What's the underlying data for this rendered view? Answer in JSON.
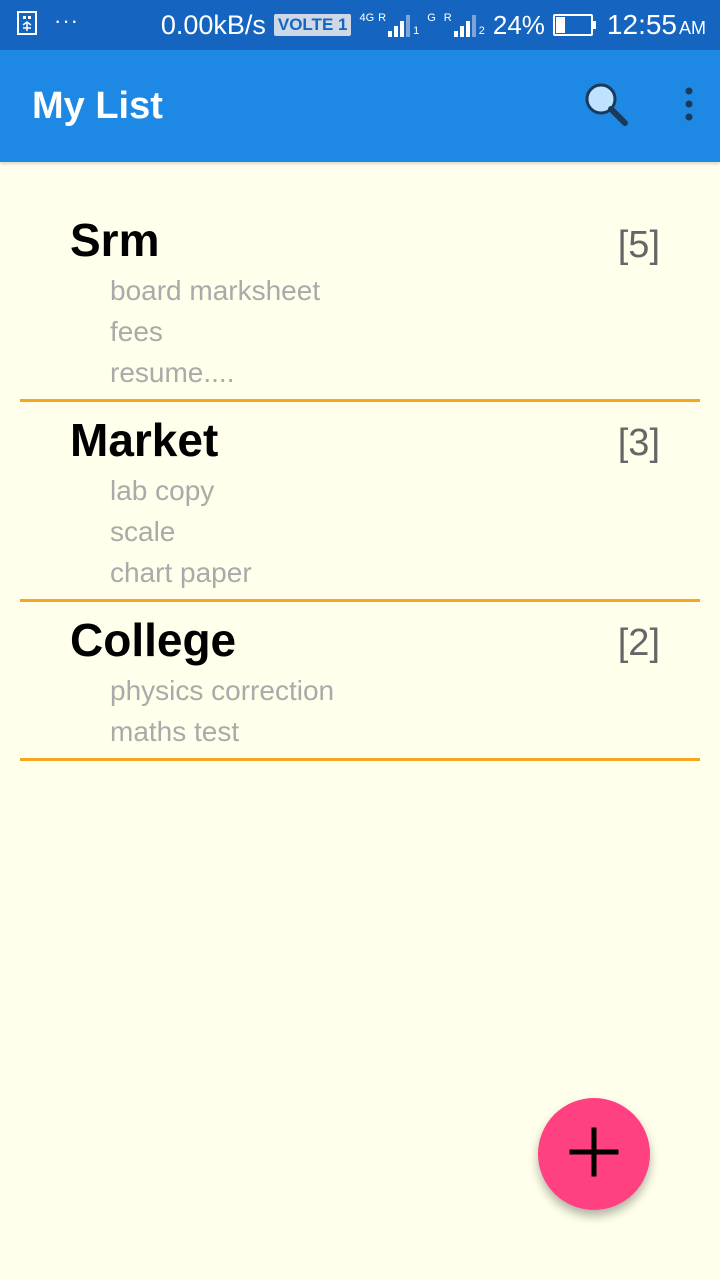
{
  "status_bar": {
    "dots": "···",
    "speed": "0.00kB/s",
    "volte": "VOLTE 1",
    "sim1_type": "4G",
    "sim1_roaming": "R",
    "sim1_index": "1",
    "sim2_type": "G",
    "sim2_roaming": "R",
    "sim2_index": "2",
    "battery": "24%",
    "battery_level": 0.24,
    "time": "12:55",
    "ampm": "AM"
  },
  "app_bar": {
    "title": "My List",
    "search_icon": "search-icon",
    "overflow_icon": "more-vert-icon",
    "color": "#1E88E5"
  },
  "lists": [
    {
      "title": "Srm",
      "count": "[5]",
      "items": [
        "board marksheet",
        "fees",
        "resume...."
      ]
    },
    {
      "title": "Market",
      "count": "[3]",
      "items": [
        "lab copy",
        "scale",
        "chart paper"
      ]
    },
    {
      "title": "College",
      "count": "[2]",
      "items": [
        "physics correction",
        "maths test"
      ]
    }
  ],
  "colors": {
    "divider": "#F5A623",
    "fab": "#FF4081",
    "background": "#FFFFEC"
  },
  "fab": {
    "icon": "add-icon"
  }
}
